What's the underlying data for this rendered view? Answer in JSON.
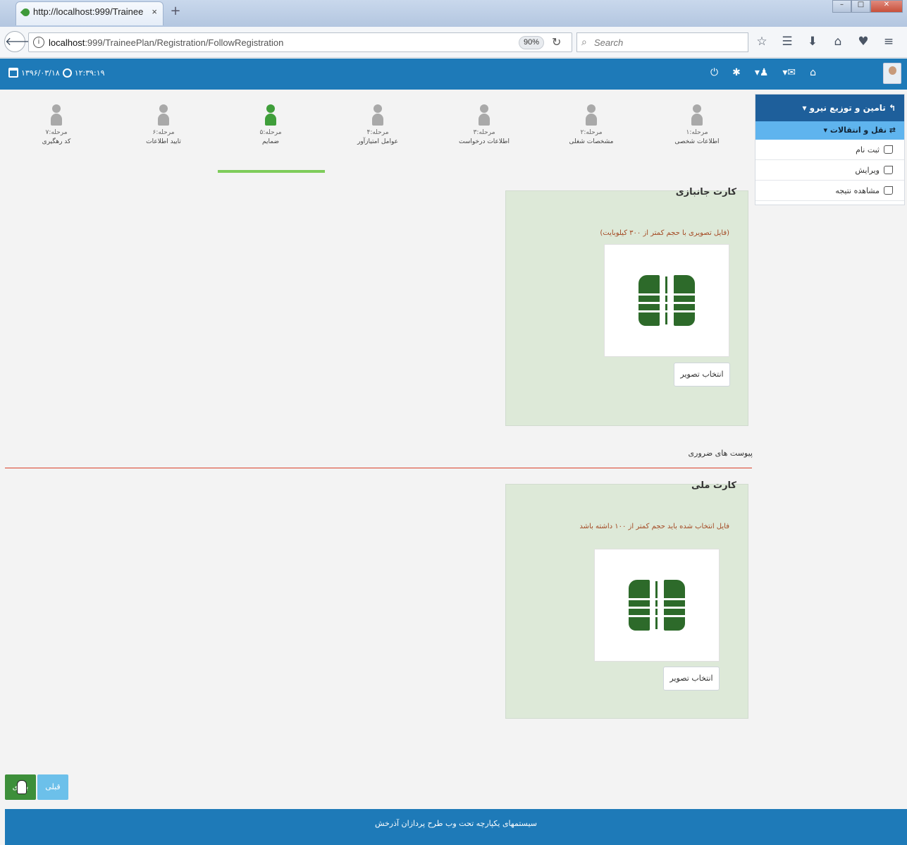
{
  "browser": {
    "tab_title": "http://localhost:999/Trainee",
    "tab_close": "×",
    "new_tab": "+",
    "url_host": "localhost",
    "url_rest": ":999/TraineePlan/Registration/FollowRegistration",
    "zoom": "90%",
    "search_placeholder": "Search"
  },
  "header": {
    "date": "۱۳۹۶/۰۳/۱۸",
    "time": "۱۲:۳۹:۱۹"
  },
  "sidebar": {
    "title": "تامین و توزیع نیرو",
    "subtitle": "نقل و انتقالات",
    "items": [
      {
        "label": "ثبت نام"
      },
      {
        "label": "ویرایش"
      },
      {
        "label": "مشاهده نتیجه"
      }
    ]
  },
  "steps": [
    {
      "num": "مرحله:۱",
      "label": "اطلاعات شخصی",
      "active": false
    },
    {
      "num": "مرحله:۲",
      "label": "مشخصات شغلی",
      "active": false
    },
    {
      "num": "مرحله:۳",
      "label": "اطلاعات درخواست",
      "active": false
    },
    {
      "num": "مرحله:۴",
      "label": "عوامل امتیازآور",
      "active": false
    },
    {
      "num": "مرحله:۵",
      "label": "ضمایم",
      "active": true
    },
    {
      "num": "مرحله:۶",
      "label": "تایید اطلاعات",
      "active": false
    },
    {
      "num": "مرحله:۷",
      "label": "کد رهگیری",
      "active": false
    }
  ],
  "cards": [
    {
      "title": "کارت جانبازی",
      "note": "(فایل تصویری با حجم کمتر از ۳۰۰ کیلوبایت)",
      "button": "انتخاب تصویر"
    },
    {
      "title": "کارت ملی",
      "note": "فایل انتخاب شده باید حجم کمتر از ۱۰۰ داشته باشد",
      "button": "انتخاب تصویر"
    }
  ],
  "section_title": "پیوست های ضروری",
  "buttons": {
    "next": "بعدی",
    "prev": "قبلی"
  },
  "footer": "سیستمهای یکپارچه تحت وب طرح پردازان آذرخش"
}
